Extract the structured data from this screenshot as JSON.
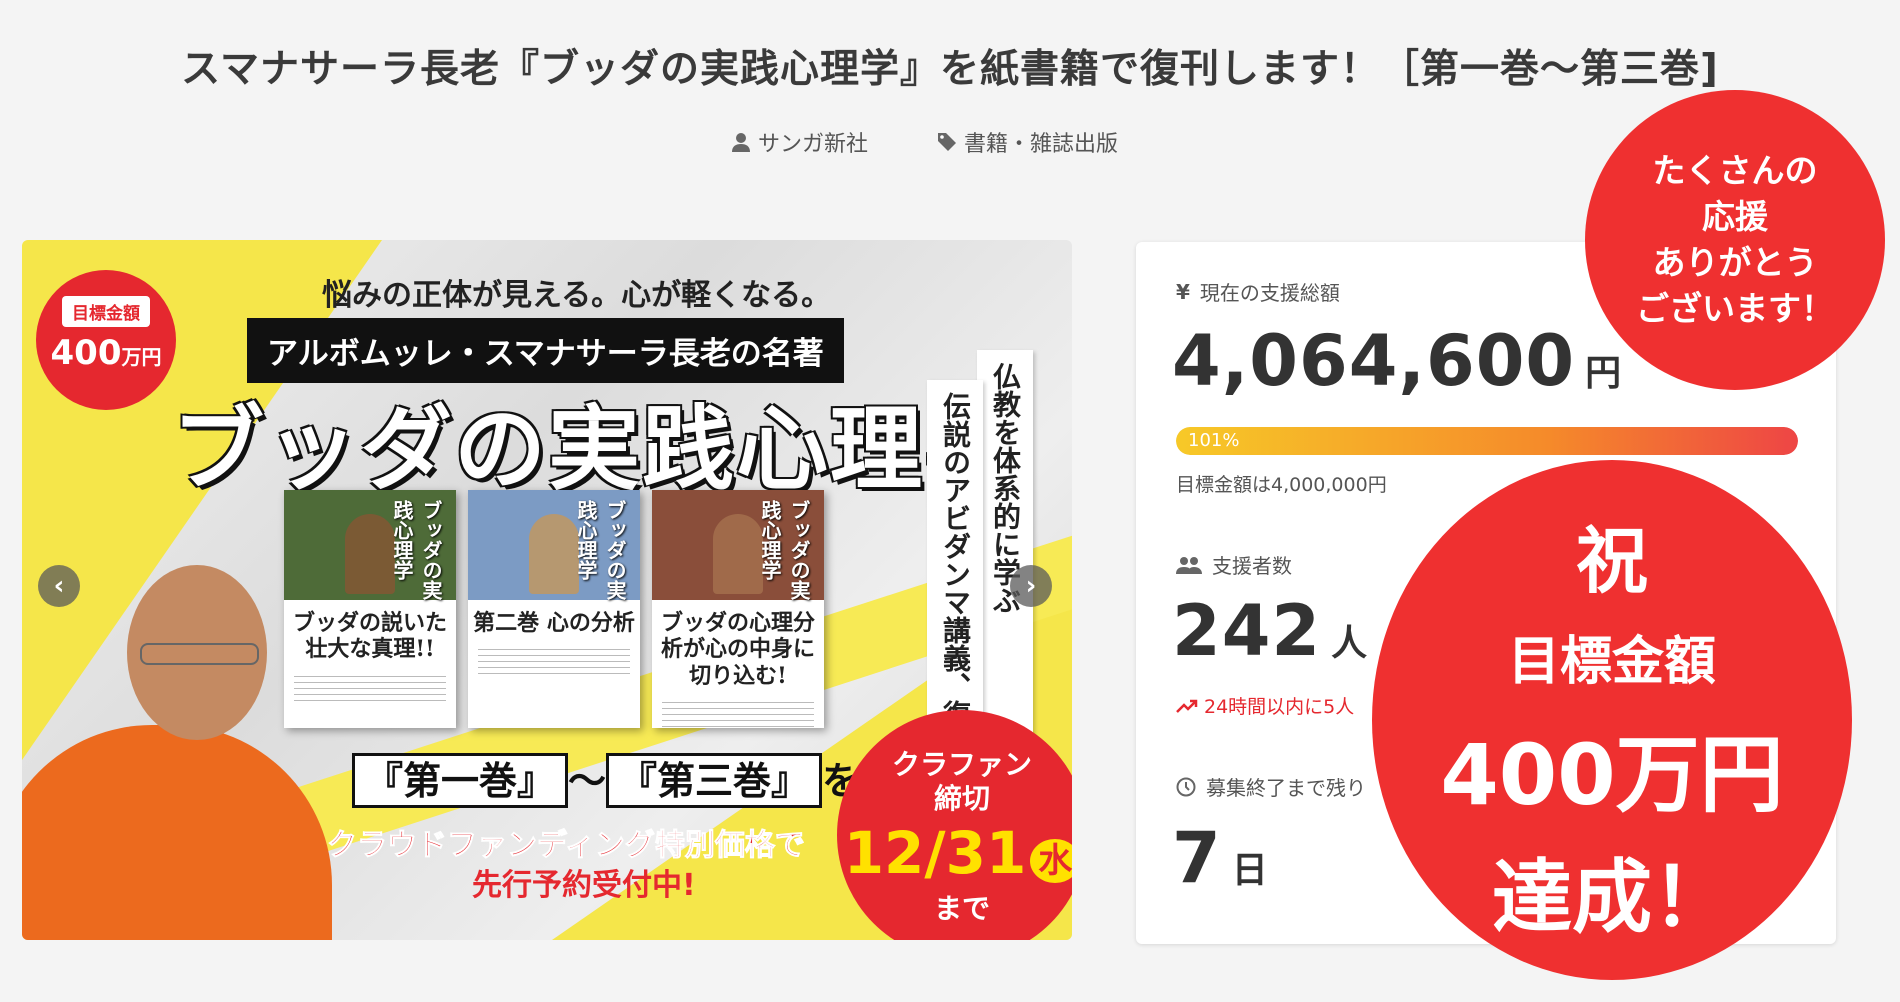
{
  "project": {
    "title": "スマナサーラ長老『ブッダの実践心理学』を紙書籍で復刊します！［第一巻〜第三巻]",
    "author": "サンガ新社",
    "category": "書籍・雑誌出版"
  },
  "hero": {
    "goal_badge_label": "目標金額",
    "goal_badge_amount": "400",
    "goal_badge_unit": "万円",
    "tagline": "悩みの正体が見える。心が軽くなる。",
    "author_bar": "アルボムッレ・スマナサーラ長老の名著",
    "book_title": "ブッダの実践心理学",
    "vertical_text_1": "仏教を体系的に学ぶ",
    "vertical_text_2": "伝説のアビダンマ講義、復刊！",
    "books": [
      {
        "cover_title": "ブッダの実践心理学",
        "blurb": "ブッダの説いた壮大な真理!!"
      },
      {
        "cover_title": "ブッダの実践心理学",
        "blurb": "第二巻 心の分析"
      },
      {
        "cover_title": "ブッダの実践心理学",
        "blurb": "ブッダの心理分析が心の中身に切り込む!"
      }
    ],
    "volumes_1": "『第一巻』",
    "volumes_sep": "〜",
    "volumes_2": "『第三巻』",
    "volumes_suffix": "を",
    "promo_line_1": "クラウドファンディング特別価格で",
    "promo_line_2": "先行予約受付中!",
    "deadline_line_1": "クラファン",
    "deadline_line_2": "締切",
    "deadline_date": "12/31",
    "deadline_weekday": "水",
    "deadline_line_3": "まで",
    "prev_icon": "‹",
    "next_icon": "›"
  },
  "stats": {
    "total_label": "現在の支援総額",
    "total_icon": "¥",
    "total_amount": "4,064,600",
    "total_unit": "円",
    "progress_percent": 101,
    "progress_label": "101%",
    "goal_text": "目標金額は4,000,000円",
    "backers_label": "支援者数",
    "backers_count": "242",
    "backers_unit": "人",
    "trend_text": "24時間以内に5人",
    "remaining_label": "募集終了まで残り",
    "remaining_count": "7",
    "remaining_unit": "日"
  },
  "overlays": {
    "thanks_lines": [
      "たくさんの",
      "応援",
      "ありがとう",
      "ございます！"
    ],
    "achieve_line_1": "祝",
    "achieve_line_2": "目標金額",
    "achieve_line_3": "400万円",
    "achieve_line_4": "達成！"
  },
  "colors": {
    "accent_red": "#ef3030",
    "hero_yellow": "#f5e64a"
  }
}
